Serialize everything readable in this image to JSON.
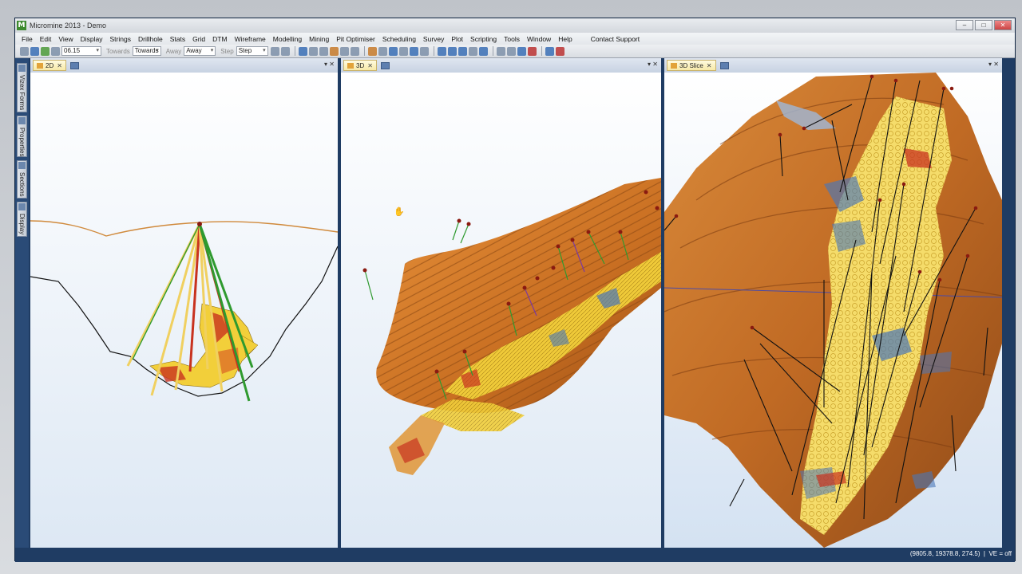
{
  "window": {
    "title": "Micromine 2013 - Demo",
    "app_icon": "M"
  },
  "menu": [
    "File",
    "Edit",
    "View",
    "Display",
    "Strings",
    "Drillhole",
    "Stats",
    "Grid",
    "DTM",
    "Wireframe",
    "Modelling",
    "Mining",
    "Pit Optimiser",
    "Scheduling",
    "Survey",
    "Plot",
    "Scripting",
    "Tools",
    "Window",
    "Help",
    "Contact Support"
  ],
  "toolbar": {
    "azimuth_value": "06.15",
    "towards_label": "Towards",
    "towards_value": "Towards",
    "away_label": "Away",
    "away_value": "Away",
    "step_label": "Step",
    "step_value": "Step"
  },
  "sidebar": {
    "tabs": [
      "Vizex Forms",
      "Properties",
      "Sections",
      "Display"
    ]
  },
  "panels": [
    {
      "tab": "2D"
    },
    {
      "tab": "3D"
    },
    {
      "tab": "3D Slice"
    }
  ],
  "status": {
    "coordinates": "(9805.8, 19378.8, 274.5)",
    "mode": "VE = off"
  },
  "colors": {
    "ore_yellow": "#f2cf3a",
    "ore_red": "#c8321f",
    "pit_orange": "#c96f22",
    "hole_green": "#2f9a2f",
    "ore_blue": "#4a76b8",
    "surface_orange": "#d98a3a"
  }
}
